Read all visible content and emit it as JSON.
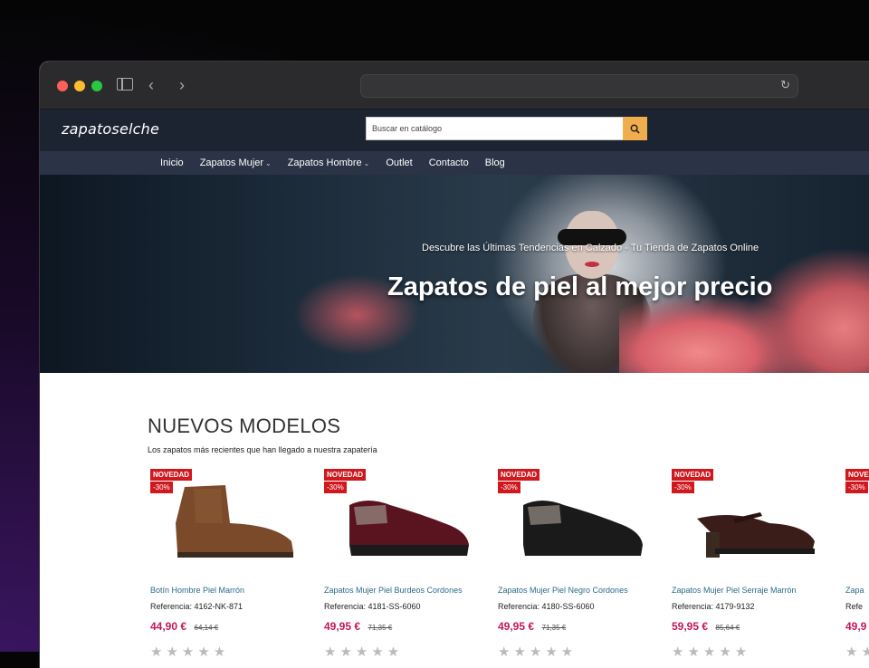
{
  "browser": {
    "url": ""
  },
  "site": {
    "logo": "zapatoselche",
    "search_placeholder": "Buscar en catálogo"
  },
  "nav": [
    {
      "label": "Inicio",
      "dropdown": false
    },
    {
      "label": "Zapatos Mujer",
      "dropdown": true
    },
    {
      "label": "Zapatos Hombre",
      "dropdown": true
    },
    {
      "label": "Outlet",
      "dropdown": false
    },
    {
      "label": "Contacto",
      "dropdown": false
    },
    {
      "label": "Blog",
      "dropdown": false
    }
  ],
  "hero": {
    "subtitle": "Descubre las Últimas Tendencias en Calzado - Tu Tienda de Zapatos Online",
    "title": "Zapatos de piel al mejor precio"
  },
  "section": {
    "title": "NUEVOS MODELOS",
    "subtitle": "Los zapatos más recientes que han llegado a nuestra zapatería"
  },
  "products": [
    {
      "badge": "NOVEDAD",
      "discount": "-30%",
      "name": "Botín Hombre Piel Marrón",
      "reference": "Referencia: 4162-NK-871",
      "price": "44,90 €",
      "old_price": "64,14 €",
      "color": "#7a4a2a",
      "kind": "boot"
    },
    {
      "badge": "NOVEDAD",
      "discount": "-30%",
      "name": "Zapatos Mujer Piel Burdeos Cordones",
      "reference": "Referencia: 4181-SS-6060",
      "price": "49,95 €",
      "old_price": "71,35 €",
      "color": "#5a1420",
      "kind": "sneaker"
    },
    {
      "badge": "NOVEDAD",
      "discount": "-30%",
      "name": "Zapatos Mujer Piel Negro Cordones",
      "reference": "Referencia: 4180-SS-6060",
      "price": "49,95 €",
      "old_price": "71,35 €",
      "color": "#1a1a1a",
      "kind": "sneaker"
    },
    {
      "badge": "NOVEDAD",
      "discount": "-30%",
      "name": "Zapatos Mujer Piel Serraje Marrón",
      "reference": "Referencia: 4179-9132",
      "price": "59,95 €",
      "old_price": "85,64 €",
      "color": "#3a1c18",
      "kind": "mary"
    },
    {
      "badge": "NOVEDAD",
      "discount": "-30%",
      "name": "Zapa",
      "reference": "Refe",
      "price": "49,9",
      "old_price": "",
      "color": "#222",
      "kind": "sneaker"
    }
  ],
  "rating_stars": "★★★★★"
}
